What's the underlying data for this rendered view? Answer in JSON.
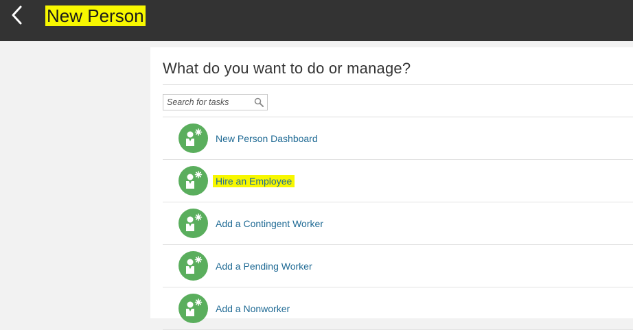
{
  "header": {
    "title": "New Person",
    "back_icon": "chevron-left-icon"
  },
  "main": {
    "heading": "What do you want to do or manage?",
    "search": {
      "placeholder": "Search for tasks",
      "value": "",
      "icon": "magnifier-icon"
    },
    "tasks": [
      {
        "label": "New Person Dashboard",
        "icon": "person-task-icon",
        "highlighted": false
      },
      {
        "label": "Hire an Employee",
        "icon": "person-task-icon",
        "highlighted": true
      },
      {
        "label": "Add a Contingent Worker",
        "icon": "person-task-icon",
        "highlighted": false
      },
      {
        "label": "Add a Pending Worker",
        "icon": "person-task-icon",
        "highlighted": false
      },
      {
        "label": "Add a Nonworker",
        "icon": "person-task-icon",
        "highlighted": false
      }
    ]
  },
  "colors": {
    "topbar": "#333333",
    "highlight": "#f7f700",
    "icon_green": "#5aae5d",
    "link": "#1f6a94"
  }
}
